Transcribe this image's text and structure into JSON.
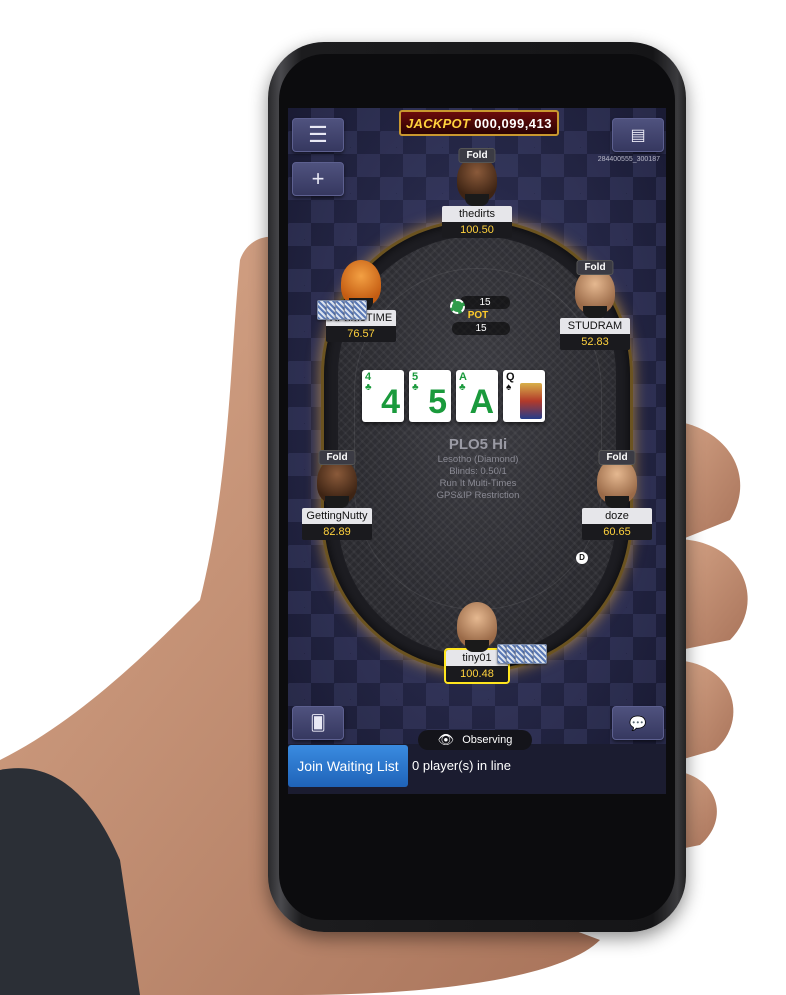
{
  "jackpot": {
    "label": "JACKPOT",
    "value": "000,099,413"
  },
  "table_id": "284400555_300187",
  "pot": {
    "amount_top": "15",
    "label": "POT",
    "amount_bottom": "15"
  },
  "board": [
    {
      "rank": "4",
      "suit": "♣",
      "color": "green"
    },
    {
      "rank": "5",
      "suit": "♣",
      "color": "green"
    },
    {
      "rank": "A",
      "suit": "♣",
      "color": "green"
    },
    {
      "rank": "Q",
      "suit": "♠",
      "color": "black"
    }
  ],
  "table_info": {
    "game": "PLO5 Hi",
    "room": "Lesotho (Diamond)",
    "blinds": "Blinds: 0.50/1",
    "run_it": "Run It Multi-Times",
    "restriction": "GPS&IP Restriction"
  },
  "players": {
    "top": {
      "name": "thedirts",
      "stack": "100.50",
      "status": "Fold"
    },
    "left_upper": {
      "name": "XPrimeTIME",
      "stack": "76.57"
    },
    "right_upper": {
      "name": "STUDRAM",
      "stack": "52.83",
      "status": "Fold"
    },
    "left_lower": {
      "name": "GettingNutty",
      "stack": "82.89",
      "status": "Fold"
    },
    "right_lower": {
      "name": "doze",
      "stack": "60.65",
      "status": "Fold"
    },
    "hero": {
      "name": "tiny01",
      "stack": "100.48"
    }
  },
  "dealer_label": "D",
  "observing_label": "Observing",
  "join_button_label": "Join Waiting List",
  "line_count_label": "0 player(s) in line",
  "icons": {
    "menu": "menu-icon",
    "add": "plus-icon",
    "notes": "notes-icon",
    "cards": "cards-icon",
    "chat": "chat-icon",
    "eye": "eye-icon"
  },
  "colors": {
    "stack_text": "#ffd23d",
    "join_button": "#2a76d2",
    "hero_highlight": "#ffe51e",
    "clubs_green": "#1a9a3c"
  }
}
